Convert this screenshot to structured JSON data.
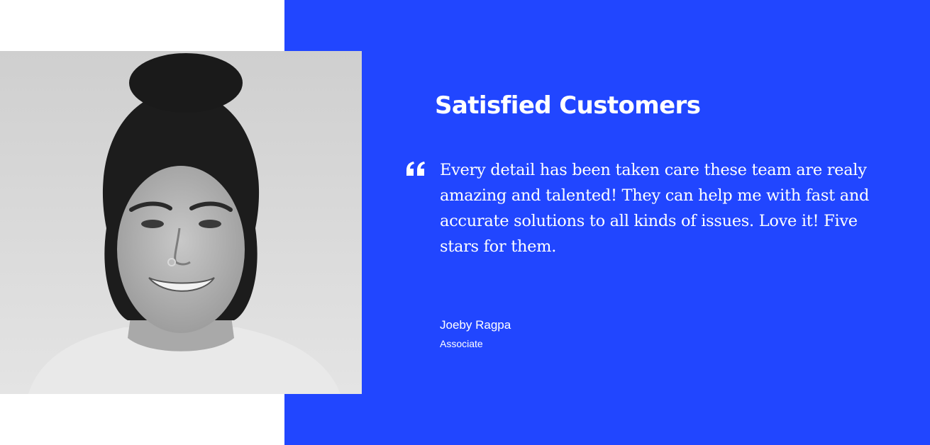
{
  "colors": {
    "panel_background": "#2146ff",
    "text": "#ffffff"
  },
  "testimonial": {
    "heading": "Satisfied Customers",
    "quote_icon": "quote-icon",
    "quote": "Every detail has been taken care these team are realy amazing and talented! They can help me with fast and accurate solutions to all kinds of issues. Love it! Five stars for them.",
    "author_name": "Joeby Ragpa",
    "author_role": "Associate"
  },
  "photo": {
    "subject": "customer-portrait",
    "style": "black-and-white"
  }
}
